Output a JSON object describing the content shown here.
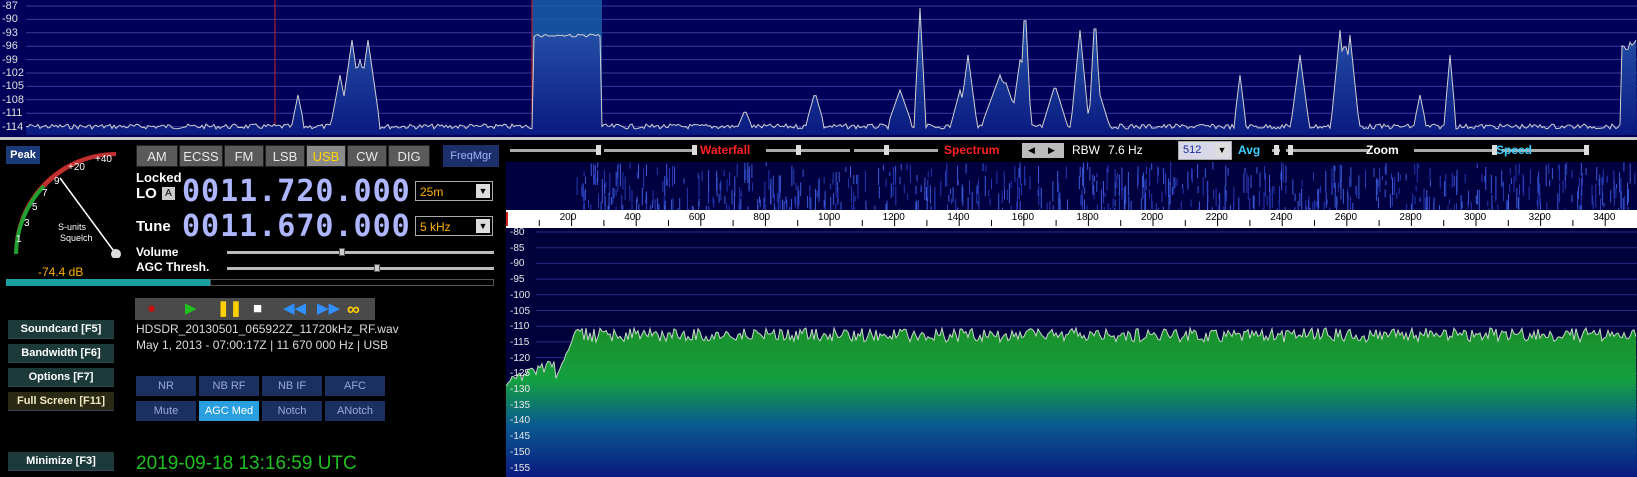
{
  "top_spectrum": {
    "db_labels": [
      "-87",
      "-90",
      "-93",
      "-96",
      "-99",
      "-102",
      "-105",
      "-108",
      "-111",
      "-114"
    ]
  },
  "left": {
    "peak_label": "Peak",
    "smeter_labels": [
      "+40",
      "+20",
      "9",
      "7",
      "5",
      "3",
      "1"
    ],
    "smeter_caption_1": "S-units",
    "smeter_caption_2": "Squelch",
    "db_readout": "-74.4 dB",
    "modes": [
      "AM",
      "ECSS",
      "FM",
      "LSB",
      "USB",
      "CW",
      "DIG"
    ],
    "active_mode": "USB",
    "freqmgr": "FreqMgr",
    "locked_label": "Locked",
    "lo_label": "LO",
    "lo_badge": "A",
    "lo_freq": "0011.720.000",
    "lo_band": "25m",
    "tune_label": "Tune",
    "tune_freq": "0011.670.000",
    "tune_step": "5 kHz",
    "volume_label": "Volume",
    "agc_thresh_label": "AGC Thresh.",
    "side_buttons": [
      {
        "label": "Soundcard [F5]"
      },
      {
        "label": "Bandwidth [F6]"
      },
      {
        "label": "Options [F7]"
      },
      {
        "label": "Full Screen [F11]"
      },
      {
        "label": "Minimize [F3]"
      }
    ],
    "file_name": "HDSDR_20130501_065922Z_11720kHz_RF.wav",
    "file_meta": "May 1, 2013 - 07:00:17Z | 11 670 000 Hz | USB",
    "ctrl_row1": [
      "NR",
      "NB RF",
      "NB IF",
      "AFC"
    ],
    "ctrl_row2": [
      "Mute",
      "AGC Med",
      "Notch",
      "ANotch"
    ],
    "clock": "2019-09-18  13:16:59 UTC"
  },
  "toolbar": {
    "waterfall": "Waterfall",
    "spectrum": "Spectrum",
    "rbw_label": "RBW",
    "rbw_value": "7.6 Hz",
    "fft_size": "512",
    "avg": "Avg",
    "zoom": "Zoom",
    "speed": "Speed",
    "colors": {
      "waterfall": "#ff2020",
      "spectrum": "#ff2020",
      "avg": "#40d0ff",
      "speed": "#40d0ff"
    }
  },
  "freq_axis": {
    "labels": [
      "200",
      "400",
      "600",
      "800",
      "1000",
      "1200",
      "1400",
      "1600",
      "1800",
      "2000",
      "2200",
      "2400",
      "2600",
      "2800",
      "3000",
      "3200",
      "3400"
    ]
  },
  "lower_spectrum": {
    "db_labels": [
      "-80",
      "-85",
      "-90",
      "-95",
      "-100",
      "-105",
      "-110",
      "-115",
      "-120",
      "-125",
      "-130",
      "-135",
      "-140",
      "-145",
      "-150",
      "-155"
    ]
  },
  "icons": {
    "record": "record-icon",
    "play": "play-icon",
    "pause": "pause-icon",
    "stop": "stop-icon",
    "rewind": "rewind-icon",
    "forward": "fast-forward-icon",
    "loop": "loop-icon"
  }
}
